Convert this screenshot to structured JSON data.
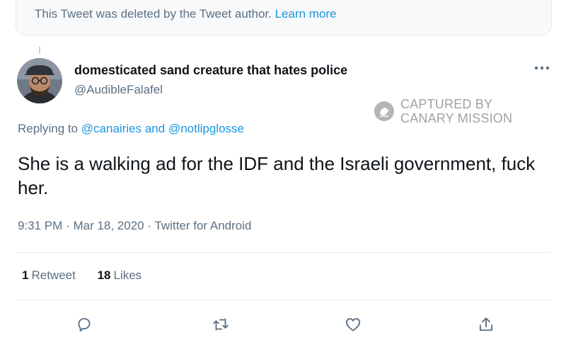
{
  "deleted_notice": {
    "text": "This Tweet was deleted by the Tweet author.",
    "link": "Learn more"
  },
  "author": {
    "display_name": "domesticated sand creature that hates police",
    "handle": "@AudibleFalafel"
  },
  "watermark": {
    "line1": "CAPTURED BY",
    "line2": "CANARY MISSION"
  },
  "reply": {
    "prefix": "Replying to",
    "mention1": "@canairies",
    "connector": "and",
    "mention2": "@notlipglosse"
  },
  "tweet": {
    "text": "She is a walking ad for the IDF and the Israeli government, fuck her."
  },
  "meta": {
    "time": "9:31 PM",
    "separator": "·",
    "date": "Mar 18, 2020",
    "source": "Twitter for Android"
  },
  "stats": {
    "retweets": {
      "count": "1",
      "label": "Retweet"
    },
    "likes": {
      "count": "18",
      "label": "Likes"
    }
  },
  "icons": {
    "more": "more-icon",
    "reply": "reply-icon",
    "retweet": "retweet-icon",
    "like": "like-icon",
    "share": "share-icon",
    "watermark": "canary-logo-icon"
  },
  "colors": {
    "link": "#1b95e0",
    "secondary_text": "#5b7083",
    "primary_text": "#0f1419"
  }
}
